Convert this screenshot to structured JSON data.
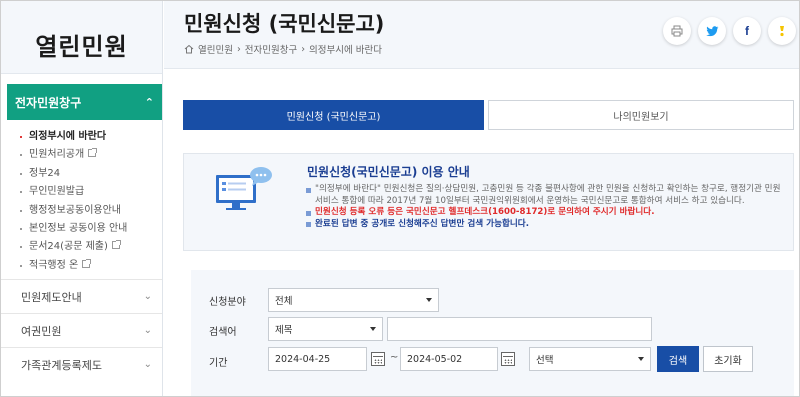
{
  "app": {
    "logo": "열린민원"
  },
  "header": {
    "title": "민원신청 (국민신문고)",
    "breadcrumb": [
      "열린민원",
      "전자민원창구",
      "의정부시에 바란다"
    ]
  },
  "sidebar": {
    "active_section": "전자민원창구",
    "sub_items": [
      {
        "label": "의정부시에 바란다",
        "current": true,
        "external": false
      },
      {
        "label": "민원처리공개",
        "current": false,
        "external": true
      },
      {
        "label": "정부24",
        "current": false,
        "external": false
      },
      {
        "label": "무인민원발급",
        "current": false,
        "external": false
      },
      {
        "label": "행정정보공동이용안내",
        "current": false,
        "external": false
      },
      {
        "label": "본인정보 공동이용 안내",
        "current": false,
        "external": false
      },
      {
        "label": "문서24(공문 제출)",
        "current": false,
        "external": true
      },
      {
        "label": "적극행정 온",
        "current": false,
        "external": true
      }
    ],
    "menus": [
      "민원제도안내",
      "여권민원",
      "가족관계등록제도"
    ]
  },
  "tabs": [
    {
      "label": "민원신청 (국민신문고)",
      "active": true
    },
    {
      "label": "나의민원보기",
      "active": false
    }
  ],
  "info": {
    "title": "민원신청(국민신문고) 이용 안내",
    "lines": [
      "\"의정부에 바란다\" 민원신청은 질의·상담민원, 고충민원 등 각종 불편사항에 관한 민원을 신청하고 확인하는 창구로, 행정기관 민원서비스 통합에 따라 2017년 7월 10일부터 국민권익위원회에서 운영하는 국민신문고로 통합하여 서비스 하고 있습니다.",
      "민원신청 등록 오류 등은 국민신문고 헬프데스크(1600-8172)로 문의하여 주시기 바랍니다.",
      "완료된 답변 중 공개로 신청해주신 답변만 검색 가능합니다."
    ]
  },
  "search": {
    "field_label": "신청분야",
    "field_value": "전체",
    "keyword_label": "검색어",
    "keyword_type": "제목",
    "keyword_value": "",
    "period_label": "기간",
    "date_from": "2024-04-25",
    "date_to": "2024-05-02",
    "period_select": "선택",
    "tilde": "~",
    "search_button": "검색",
    "reset_button": "초기화"
  },
  "colors": {
    "accent_green": "#11a082",
    "primary_blue": "#184ea6",
    "title_navy": "#1b3e92",
    "warning_red": "#e02b2b"
  },
  "social_icons": [
    "print-icon",
    "twitter-icon",
    "facebook-icon",
    "kakao-icon"
  ]
}
